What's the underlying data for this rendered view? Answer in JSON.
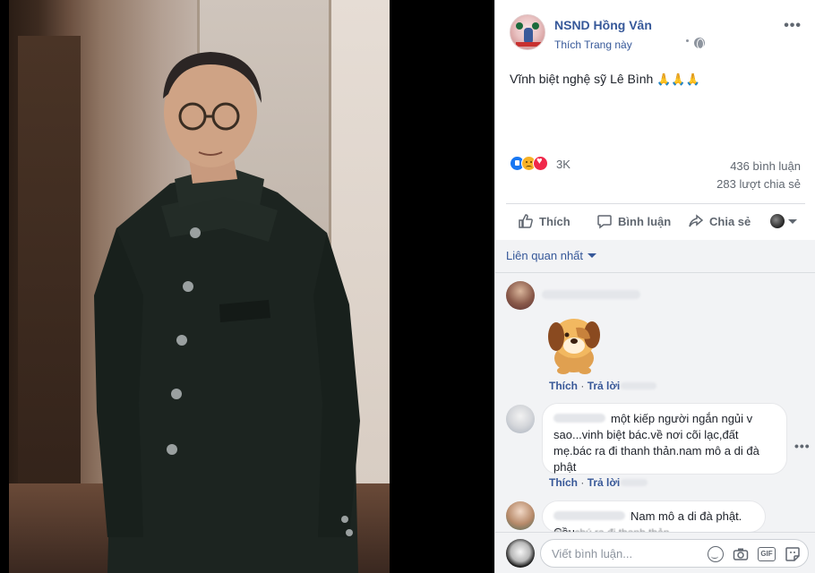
{
  "post": {
    "page_name": "NSND Hồng Vân",
    "like_page": "Thích Trang này",
    "text": "Vĩnh biệt nghệ sỹ Lê Bình",
    "pray_emoji": "🙏🙏🙏",
    "reaction_count": "3K",
    "comments_count": "436 bình luận",
    "shares_count": "283 lượt chia sẻ"
  },
  "actions": {
    "like": "Thích",
    "comment": "Bình luận",
    "share": "Chia sẻ"
  },
  "comments": {
    "sort_label": "Liên quan nhất",
    "c1": {
      "like": "Thích",
      "reply": "Trả lời"
    },
    "c2": {
      "text": "một kiếp người ngắn ngủi v sao...vinh biệt bác.về nơi cõi lạc,đất mẹ.bác ra đi thanh thản.nam mô a di đà phật",
      "like": "Thích",
      "reply": "Trả lời"
    },
    "c3": {
      "text": "Nam mô a di đà phật. Cầu",
      "text_partial": "nho chú ra đi thanh thản"
    }
  },
  "composer": {
    "placeholder": "Viết bình luận..."
  },
  "colors": {
    "link": "#365899",
    "text": "#1d2129",
    "muted": "#606770",
    "comment_bg": "#f2f3f5"
  }
}
